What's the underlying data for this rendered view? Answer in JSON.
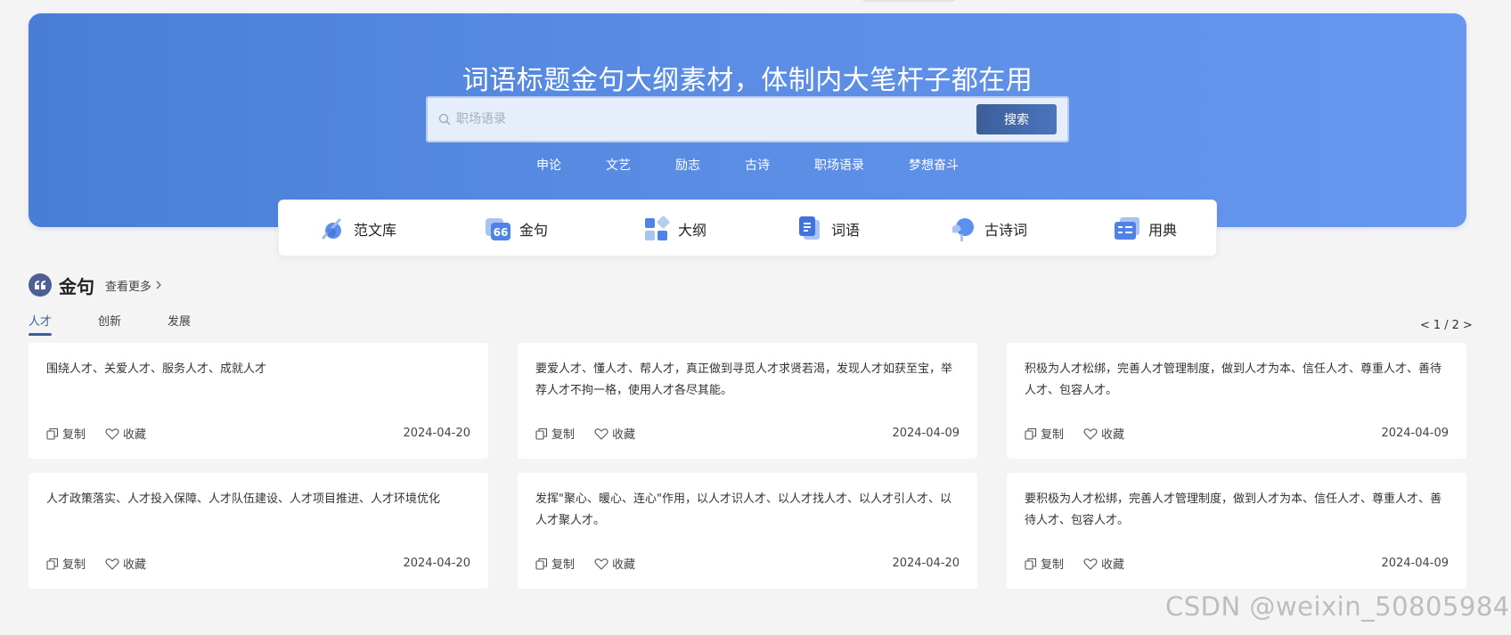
{
  "hero": {
    "title": "词语标题金句大纲素材，体制内大笔杆子都在用",
    "search_placeholder": "职场语录",
    "search_button": "搜索",
    "hot_tags": [
      "申论",
      "文艺",
      "励志",
      "古诗",
      "职场语录",
      "梦想奋斗"
    ]
  },
  "categories": [
    {
      "label": "范文库",
      "icon": "pen-paper-icon"
    },
    {
      "label": "金句",
      "icon": "quote-card-icon"
    },
    {
      "label": "大纲",
      "icon": "grid-blocks-icon"
    },
    {
      "label": "词语",
      "icon": "document-list-icon"
    },
    {
      "label": "古诗词",
      "icon": "scroll-ball-icon"
    },
    {
      "label": "用典",
      "icon": "book-lines-icon"
    }
  ],
  "section": {
    "title": "金句",
    "see_more": "查看更多",
    "tabs": [
      "人才",
      "创新",
      "发展"
    ],
    "active_tab": "人才",
    "pager": {
      "prev": "<",
      "current": "1",
      "separator": "/",
      "total": "2",
      "next": ">"
    }
  },
  "actions": {
    "copy": "复制",
    "favorite": "收藏"
  },
  "cards": [
    {
      "text": "围绕人才、关爱人才、服务人才、成就人才",
      "date": "2024-04-20"
    },
    {
      "text": "要爱人才、懂人才、帮人才，真正做到寻觅人才求贤若渴，发现人才如获至宝，举荐人才不拘一格，使用人才各尽其能。",
      "date": "2024-04-09"
    },
    {
      "text": "积极为人才松绑，完善人才管理制度，做到人才为本、信任人才、尊重人才、善待人才、包容人才。",
      "date": "2024-04-09"
    },
    {
      "text": "人才政策落实、人才投入保障、人才队伍建设、人才项目推进、人才环境优化",
      "date": "2024-04-20"
    },
    {
      "text": "发挥\"聚心、暖心、连心\"作用，以人才识人才、以人才找人才、以人才引人才、以人才聚人才。",
      "date": "2024-04-20"
    },
    {
      "text": "要积极为人才松绑，完善人才管理制度，做到人才为本、信任人才、尊重人才、善待人才、包容人才。",
      "date": "2024-04-09"
    }
  ],
  "watermark": "CSDN @weixin_50805984",
  "colors": {
    "hero_start": "#4a7ed5",
    "hero_end": "#6797ef",
    "accent": "#3c5e98",
    "page_bg": "#f4f4f5"
  }
}
